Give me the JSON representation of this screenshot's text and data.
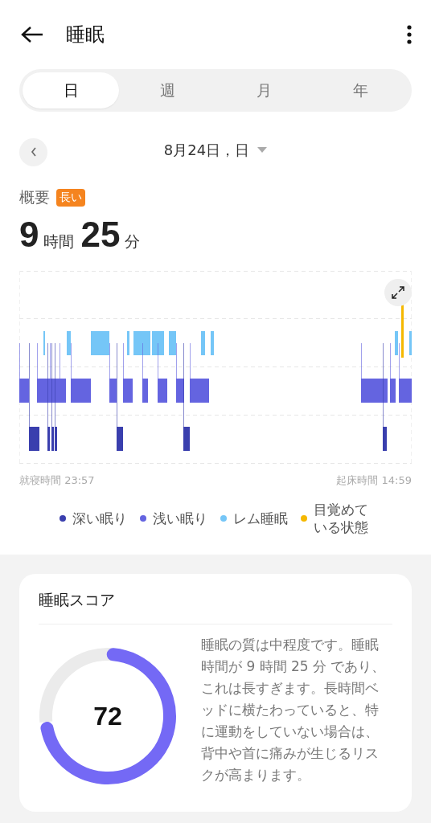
{
  "header": {
    "title": "睡眠"
  },
  "tabs": [
    {
      "label": "日",
      "selected": true
    },
    {
      "label": "週",
      "selected": false
    },
    {
      "label": "月",
      "selected": false
    },
    {
      "label": "年",
      "selected": false
    }
  ],
  "date": {
    "label": "8月24日，日"
  },
  "summary": {
    "label": "概要",
    "badge": "長い",
    "hours": "9",
    "hours_unit": "時間",
    "minutes": "25",
    "minutes_unit": "分"
  },
  "chart": {
    "bedtime": "就寝時間 23:57",
    "wake_time": "起床時間 14:59"
  },
  "legend": [
    {
      "label": "深い眠り",
      "color": "#3a3fae"
    },
    {
      "label": "浅い眠り",
      "color": "#6464e0"
    },
    {
      "label": "レム睡眠",
      "color": "#75c6f7"
    },
    {
      "label": "目覚めている状態",
      "color": "#f5b800"
    }
  ],
  "score_card": {
    "title": "睡眠スコア",
    "score": "72",
    "description": "睡眠の質は中程度です。睡眠時間が 9 時間 25 分 であり、これは長すぎます。長時間ベッドに横たわっていると、特に運動をしていない場合は、背中や首に痛みが生じるリスクが高まります。"
  }
}
